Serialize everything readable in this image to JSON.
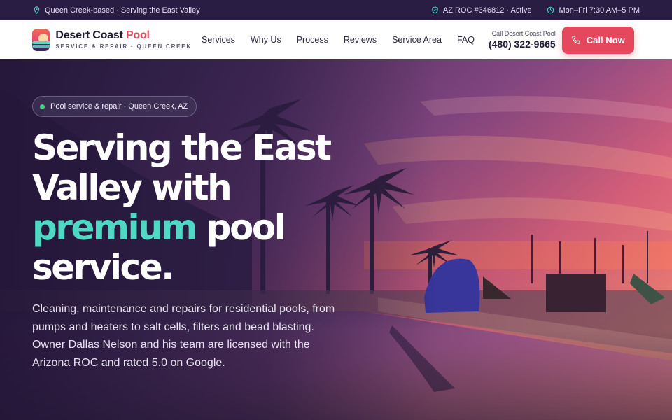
{
  "topbar": {
    "location": "Queen Creek-based · Serving the East Valley",
    "license": "AZ ROC #346812 · Active",
    "hours": "Mon–Fri 7:30 AM–5 PM",
    "icons": [
      "map-pin-icon",
      "shield-check-icon",
      "clock-icon"
    ]
  },
  "header": {
    "brand_name": "Desert Coast",
    "brand_accent": "Pool",
    "brand_tagline": "SERVICE & REPAIR · QUEEN CREEK",
    "nav": [
      "Services",
      "Why Us",
      "Process",
      "Reviews",
      "Service Area",
      "FAQ"
    ],
    "call_label": "Call Desert Coast Pool",
    "phone": "(480) 322-9665",
    "cta_label": "Call Now"
  },
  "hero": {
    "pill": "Pool service & repair · Queen Creek, AZ",
    "headline_line1": "Serving the East",
    "headline_line2": "Valley with",
    "headline_highlight": "premium",
    "headline_after_highlight": "pool",
    "headline_line4": "service.",
    "subcopy": "Cleaning, maintenance and repairs for residential pools, from pumps and heaters to salt cells, filters and bead blasting. Owner Dallas Nelson and his team are licensed with the Arizona ROC and rated 5.0 on Google."
  },
  "colors": {
    "topbar_bg": "#2a1d44",
    "accent_red": "#e5485c",
    "accent_teal": "#4fd8c4",
    "status_green": "#3ed67f"
  }
}
